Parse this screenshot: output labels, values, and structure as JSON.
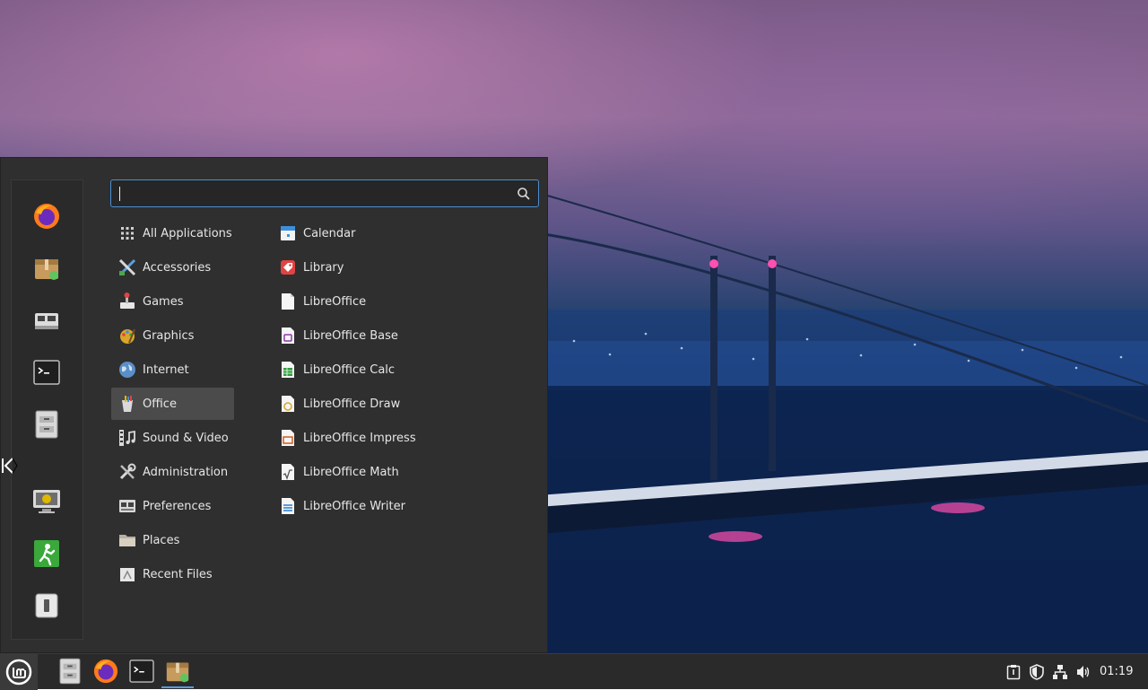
{
  "search": {
    "value": "",
    "placeholder": ""
  },
  "favorites": [
    {
      "name": "firefox-icon"
    },
    {
      "name": "software-manager-icon"
    },
    {
      "name": "system-settings-icon"
    },
    {
      "name": "terminal-icon"
    },
    {
      "name": "files-icon"
    },
    {
      "name": "lock-screen-icon"
    },
    {
      "name": "logout-icon"
    },
    {
      "name": "shutdown-icon"
    }
  ],
  "categories": [
    {
      "label": "All Applications",
      "icon": "grid-icon"
    },
    {
      "label": "Accessories",
      "icon": "accessories-icon"
    },
    {
      "label": "Games",
      "icon": "games-icon"
    },
    {
      "label": "Graphics",
      "icon": "graphics-icon"
    },
    {
      "label": "Internet",
      "icon": "internet-icon"
    },
    {
      "label": "Office",
      "icon": "office-icon",
      "selected": true
    },
    {
      "label": "Sound & Video",
      "icon": "sound-video-icon"
    },
    {
      "label": "Administration",
      "icon": "administration-icon"
    },
    {
      "label": "Preferences",
      "icon": "preferences-icon"
    },
    {
      "label": "Places",
      "icon": "folder-icon"
    },
    {
      "label": "Recent Files",
      "icon": "recent-files-icon"
    }
  ],
  "apps": [
    {
      "label": "Calendar",
      "icon": "calendar-icon",
      "color": "#3c8fdc"
    },
    {
      "label": "Library",
      "icon": "library-icon",
      "color": "#e04343"
    },
    {
      "label": "LibreOffice",
      "icon": "libreoffice-icon",
      "color": "#ffffff"
    },
    {
      "label": "LibreOffice Base",
      "icon": "libreoffice-base-icon",
      "color": "#8e3aa8"
    },
    {
      "label": "LibreOffice Calc",
      "icon": "libreoffice-calc-icon",
      "color": "#2e9c3c"
    },
    {
      "label": "LibreOffice Draw",
      "icon": "libreoffice-draw-icon",
      "color": "#d9a62a"
    },
    {
      "label": "LibreOffice Impress",
      "icon": "libreoffice-impress-icon",
      "color": "#d45b1e"
    },
    {
      "label": "LibreOffice Math",
      "icon": "libreoffice-math-icon",
      "color": "#666666"
    },
    {
      "label": "LibreOffice Writer",
      "icon": "libreoffice-writer-icon",
      "color": "#2a7fd0"
    }
  ],
  "panel": {
    "launchers": [
      "files-icon",
      "firefox-icon",
      "terminal-icon",
      "software-manager-icon"
    ],
    "tray": [
      "clipboard-icon",
      "update-shield-icon",
      "network-icon",
      "volume-icon"
    ],
    "clock": "01:19"
  },
  "colors": {
    "accent": "#4a8fd1",
    "panel": "#2a2a2a",
    "menu": "#2f2f2f"
  }
}
